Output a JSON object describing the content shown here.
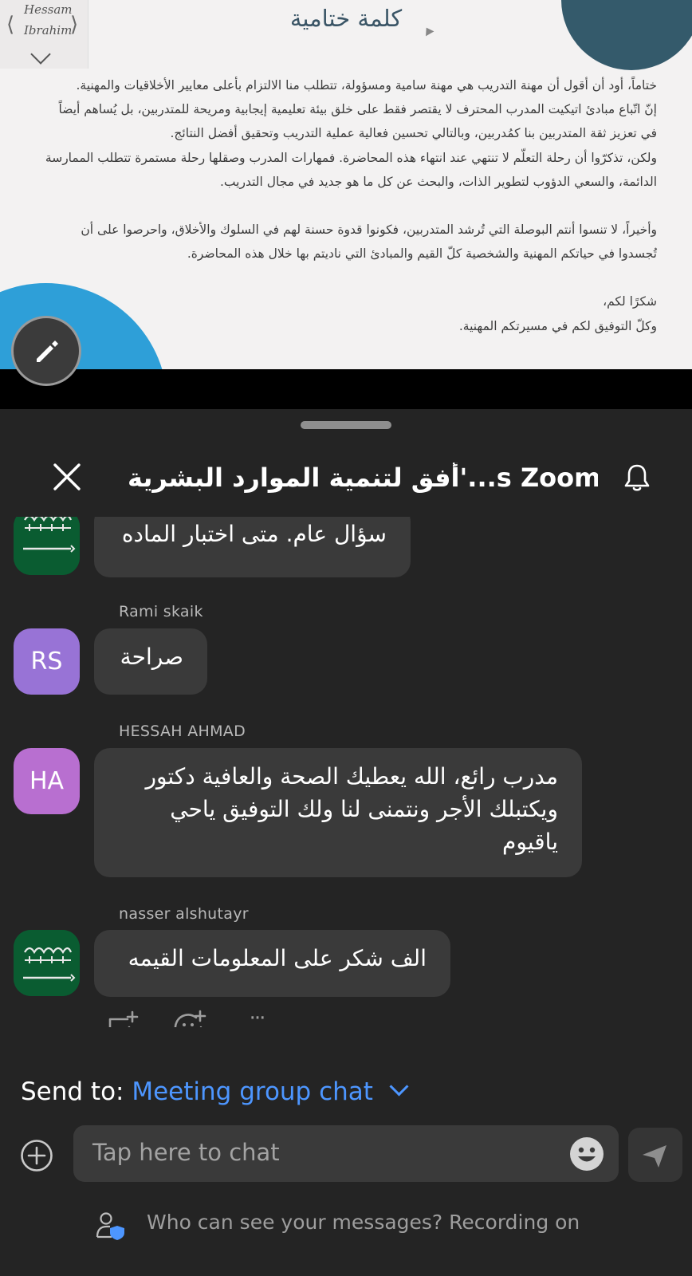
{
  "slide": {
    "logo_line1": "Hessam",
    "logo_line2": "Ibrahim",
    "title": "كلمة ختامية",
    "paragraphs": [
      "ختاماً، أود أن أقول أن مهنة التدريب هي مهنة سامية ومسؤولة، تتطلب منا الالتزام بأعلى معايير الأخلاقيات والمهنية.",
      "إنّ اتّباع مبادئ اتيكيت المدرب المحترف لا يقتصر فقط على خلق بيئة تعليمية إيجابية ومريحة للمتدربين، بل يُساهم أيضاً في تعزيز ثقة المتدربين بنا كمُدربين، وبالتالي تحسين فعالية عملية التدريب وتحقيق أفضل النتائج.",
      "ولكن، تذكرّوا أن رحلة التعلّم لا تنتهي عند انتهاء هذه المحاضرة. فمهارات المدرب وصقلها رحلة مستمرة تتطلب الممارسة الدائمة، والسعي الدؤوب لتطوير الذات، والبحث عن كل ما هو جديد في مجال التدريب.",
      "وأخيراً، لا تنسوا أنتم البوصلة التي تُرشد المتدربين، فكونوا قدوة حسنة لهم في السلوك والأخلاق، واحرصوا على أن تُجسدوا في حياتكم المهنية والشخصية كلّ القيم والمبادئ التي ناديتم بها خلال هذه المحاضرة.",
      "شكرًا لكم،",
      "وكلّ التوفيق لكم في مسيرتكم المهنية."
    ]
  },
  "header": {
    "title": "أفق لتنمية الموارد البشرية'...s Zoom Me"
  },
  "messages": [
    {
      "sender": "",
      "initials": "",
      "avatar": "flag",
      "text": "سؤال عام.  متى اختبار الماده"
    },
    {
      "sender": "Rami skaik",
      "initials": "RS",
      "avatar": "rs",
      "text": "صراحة"
    },
    {
      "sender": "HESSAH AHMAD",
      "initials": "HA",
      "avatar": "ha",
      "text": "مدرب رائع، الله يعطيك الصحة والعافية دكتور ويكتبلك الأجر ونتمنى لنا ولك التوفيق ياحي ياقيوم"
    },
    {
      "sender": "nasser alshutayr",
      "initials": "",
      "avatar": "flag",
      "text": "الف شكر على المعلومات القيمه"
    }
  ],
  "actions": {
    "more_label": "···"
  },
  "composer": {
    "send_to_label": "Send to:",
    "send_to_target": "Meeting group chat",
    "placeholder": "Tap here to chat",
    "footer": "Who can see your messages? Recording on"
  },
  "colors": {
    "accent": "#4d96ff",
    "panel_bg": "#242424",
    "bubble_bg": "#3a3a3a"
  }
}
